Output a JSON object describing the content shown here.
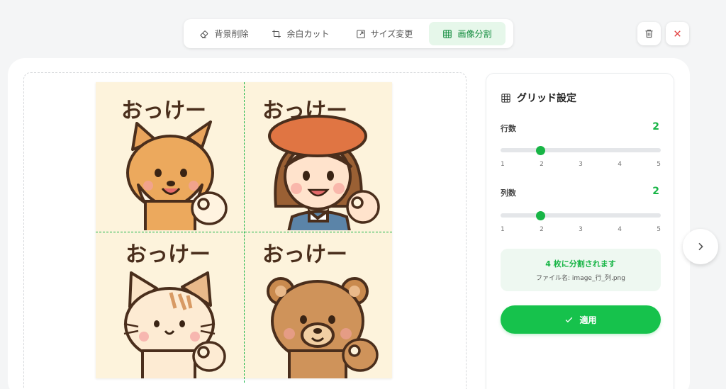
{
  "toolbar": {
    "tabs": [
      {
        "label": "背景削除",
        "icon": "eraser-icon",
        "active": false
      },
      {
        "label": "余白カット",
        "icon": "crop-icon",
        "active": false
      },
      {
        "label": "サイズ変更",
        "icon": "resize-icon",
        "active": false
      },
      {
        "label": "画像分割",
        "icon": "grid-icon",
        "active": true
      }
    ],
    "actions": [
      {
        "icon": "trash-icon"
      },
      {
        "icon": "close-icon"
      }
    ]
  },
  "image": {
    "cells": [
      {
        "caption": "おっけー",
        "character": "shiba-dog"
      },
      {
        "caption": "おっけー",
        "character": "girl-red-beret"
      },
      {
        "caption": "おっけー",
        "character": "tabby-cat"
      },
      {
        "caption": "おっけー",
        "character": "brown-bear"
      }
    ],
    "grid_rows": 2,
    "grid_cols": 2
  },
  "settings": {
    "title": "グリッド設定",
    "rows": {
      "label": "行数",
      "value": "2",
      "min": 1,
      "max": 5,
      "ticks": [
        "1",
        "2",
        "3",
        "4",
        "5"
      ]
    },
    "cols": {
      "label": "列数",
      "value": "2",
      "min": 1,
      "max": 5,
      "ticks": [
        "1",
        "2",
        "3",
        "4",
        "5"
      ]
    },
    "info": {
      "count_text": "4 枚に分割されます",
      "filename_text": "ファイル名: image_行_列.png"
    },
    "apply_label": "適用"
  },
  "colors": {
    "accent": "#18b546",
    "apply_button": "#16c24c",
    "active_tab_bg": "#e6f7ea",
    "close_red": "#e23b3b",
    "image_bg": "#fdf3dc"
  }
}
